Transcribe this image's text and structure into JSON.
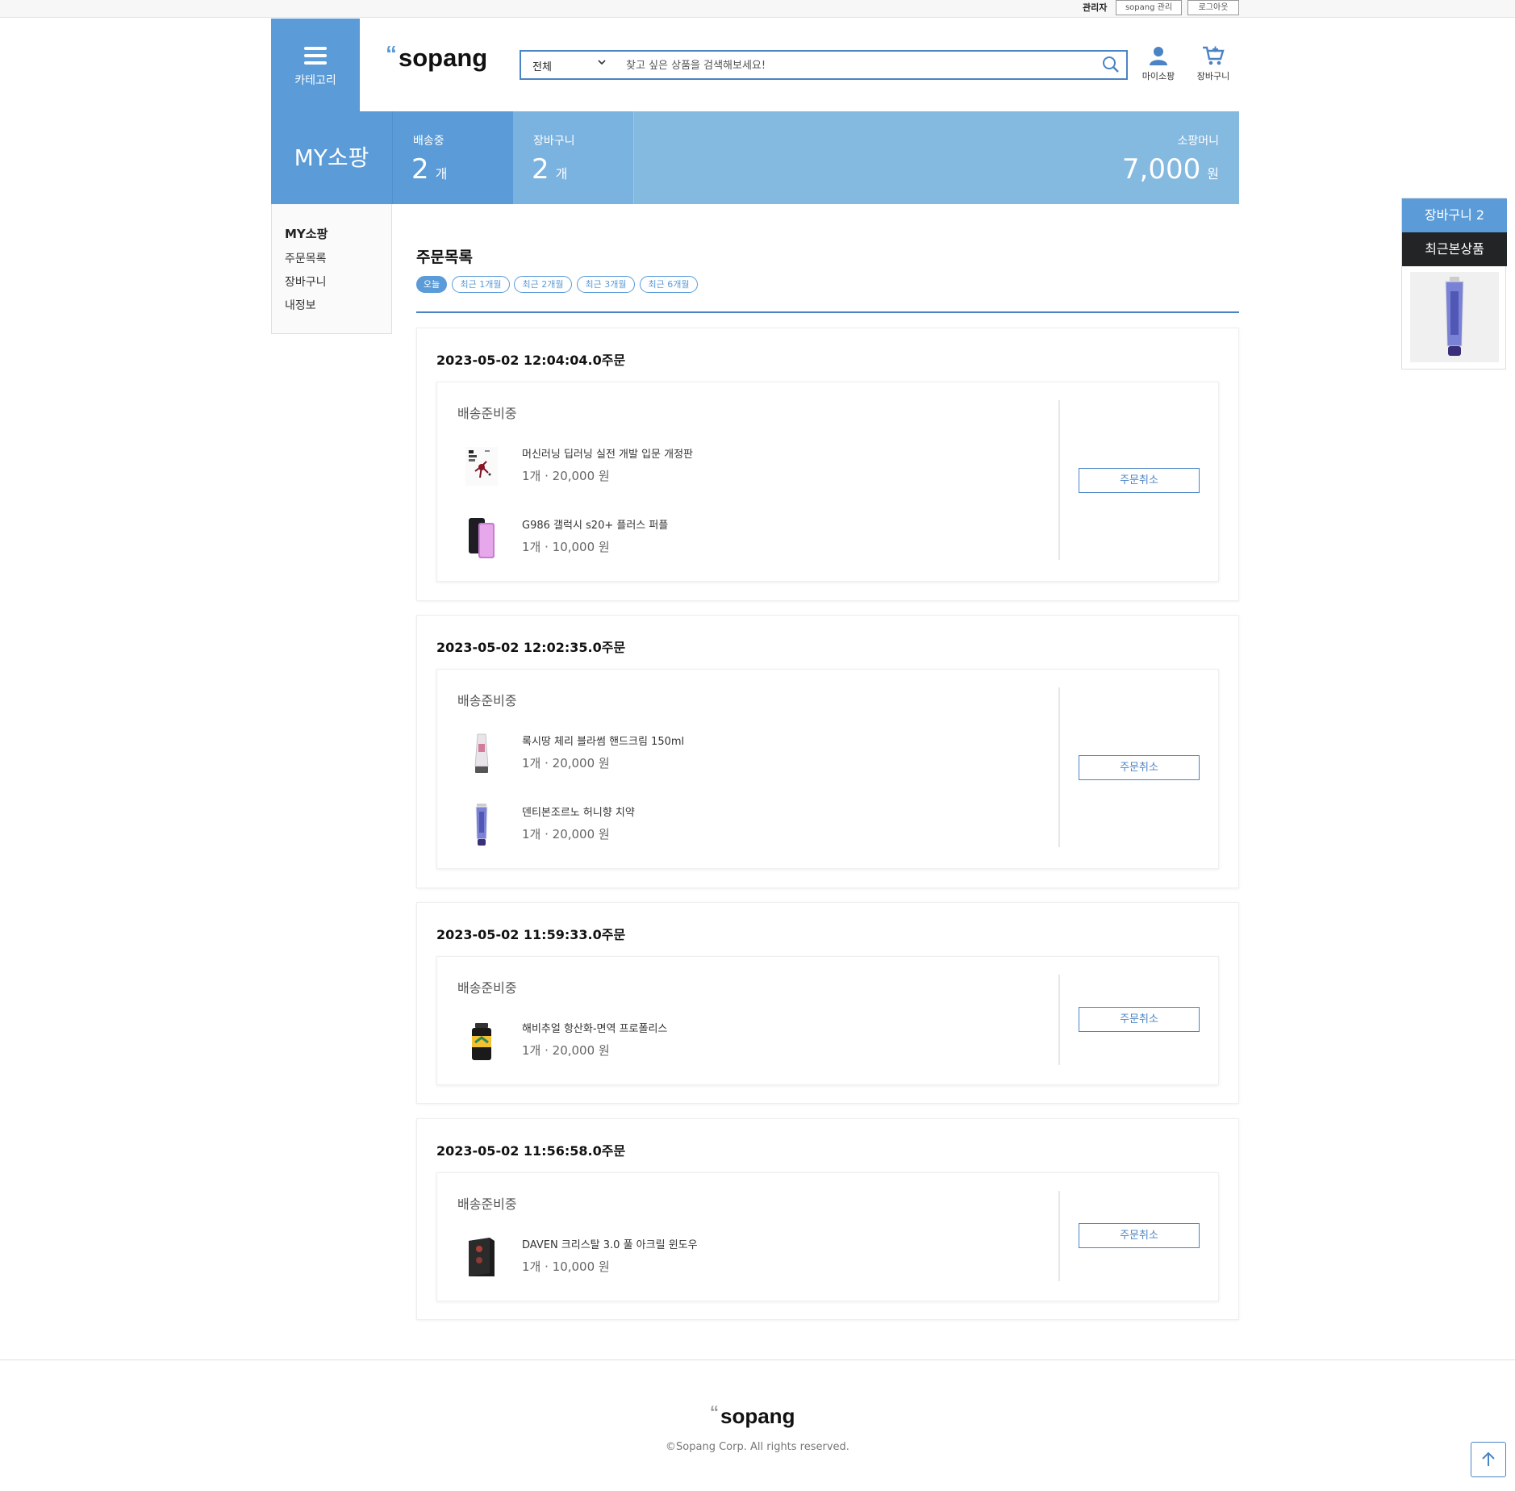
{
  "topbar": {
    "admin_label": "관리자",
    "admin_link": "sopang 관리",
    "logout": "로그아웃"
  },
  "header": {
    "category_label": "카테고리",
    "logo_text": "sopang",
    "search": {
      "selected_category": "전체",
      "placeholder": "찾고 싶은 상품을 검색해보세요!"
    },
    "mypage_label": "마이소팡",
    "cart_label": "장바구니"
  },
  "banner": {
    "title": "MY소팡",
    "shipping": {
      "label": "배송중",
      "count": "2",
      "unit": "개"
    },
    "cart": {
      "label": "장바구니",
      "count": "2",
      "unit": "개"
    },
    "money": {
      "label": "소팡머니",
      "amount": "7,000",
      "unit": "원"
    }
  },
  "sidemenu": {
    "heading": "MY소팡",
    "items": [
      "주문목록",
      "장바구니",
      "내정보"
    ]
  },
  "content": {
    "title": "주문목록",
    "filters": [
      "오늘",
      "최근 1개월",
      "최근 2개월",
      "최근 3개월",
      "최근 6개월"
    ],
    "active_filter": "오늘",
    "orders": [
      {
        "date": "2023-05-02 12:04:04.0주문",
        "status": "배송준비중",
        "cancel_label": "주문취소",
        "items": [
          {
            "name": "머신러닝 딥러닝 실전 개발 입문 개정판",
            "qty_price": "1개 · 20,000 원",
            "icon": "book-icon"
          },
          {
            "name": "G986 갤럭시 s20+ 플러스 퍼플",
            "qty_price": "1개 · 10,000 원",
            "icon": "phone-icon"
          }
        ]
      },
      {
        "date": "2023-05-02 12:02:35.0주문",
        "status": "배송준비중",
        "cancel_label": "주문취소",
        "items": [
          {
            "name": "록시땅 체리 블라썸 핸드크림 150ml",
            "qty_price": "1개 · 20,000 원",
            "icon": "handcream-icon"
          },
          {
            "name": "덴티본조르노 허니향 치약",
            "qty_price": "1개 · 20,000 원",
            "icon": "toothpaste-icon"
          }
        ]
      },
      {
        "date": "2023-05-02 11:59:33.0주문",
        "status": "배송준비중",
        "cancel_label": "주문취소",
        "items": [
          {
            "name": "해비추얼 항산화-면역 프로폴리스",
            "qty_price": "1개 · 20,000 원",
            "icon": "supplement-bottle-icon"
          }
        ]
      },
      {
        "date": "2023-05-02 11:56:58.0주문",
        "status": "배송준비중",
        "cancel_label": "주문취소",
        "items": [
          {
            "name": "DAVEN 크리스탈 3.0 풀 아크릴 윈도우",
            "qty_price": "1개 · 10,000 원",
            "icon": "pc-case-icon"
          }
        ]
      }
    ]
  },
  "floating": {
    "cart_label": "장바구니 2",
    "recent_label": "최근본상품"
  },
  "footer": {
    "logo_text": "sopang",
    "copyright": "©Sopang Corp. All rights reserved."
  },
  "colors": {
    "primary": "#5a9bd8",
    "primary_light": "#84b9e0",
    "border_blue": "#4a84c4",
    "dark": "#222426"
  }
}
